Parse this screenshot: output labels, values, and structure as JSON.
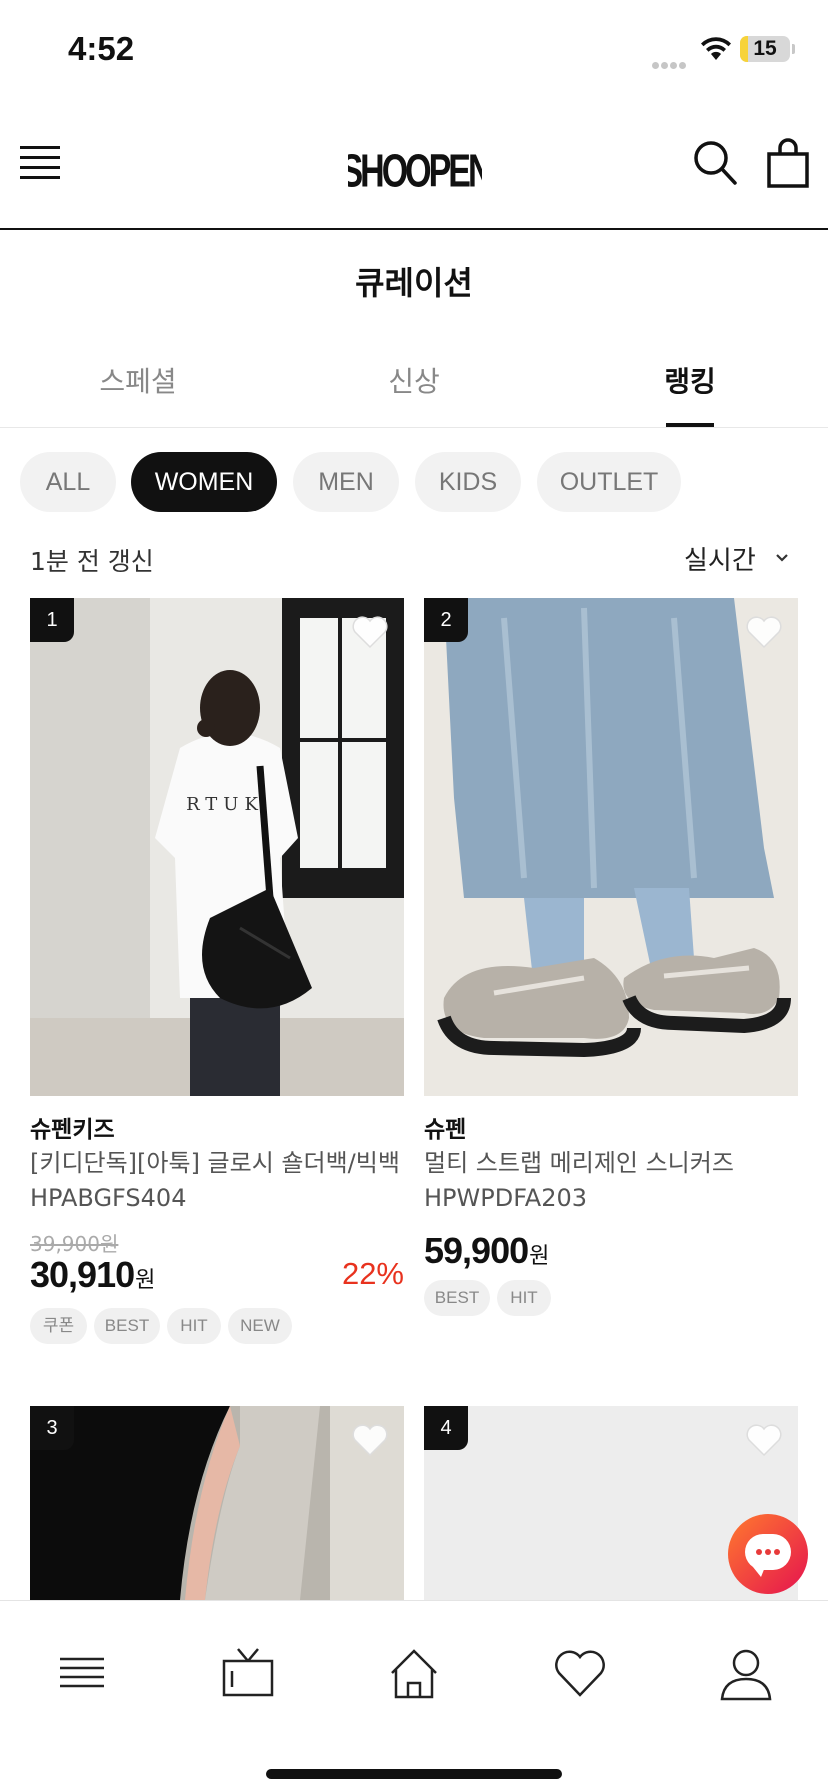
{
  "status_bar": {
    "time": "4:52",
    "battery": "15",
    "battery_level": 0.15
  },
  "header": {
    "logo_text": "SHOOPEN"
  },
  "page": {
    "title": "큐레이션"
  },
  "tabs": [
    {
      "label": "스페셜",
      "active": false
    },
    {
      "label": "신상",
      "active": false
    },
    {
      "label": "랭킹",
      "active": true
    }
  ],
  "filters": [
    {
      "label": "ALL",
      "active": false
    },
    {
      "label": "WOMEN",
      "active": true
    },
    {
      "label": "MEN",
      "active": false
    },
    {
      "label": "KIDS",
      "active": false
    },
    {
      "label": "OUTLET",
      "active": false
    }
  ],
  "update_text": "1분 전 갱신",
  "sort": {
    "selected": "실시간"
  },
  "products": [
    {
      "rank": "1",
      "brand": "슈펜키즈",
      "name_line1": "[키디단독][아툭] 글로시 숄더백/빅백",
      "name_line2": "HPABGFS404",
      "original_price": "39,900원",
      "price": "30,910",
      "currency": "원",
      "discount": "22%",
      "badges": [
        "쿠폰",
        "BEST",
        "HIT",
        "NEW"
      ],
      "shirt_print": "RTUK"
    },
    {
      "rank": "2",
      "brand": "슈펜",
      "name_line1": "멀티 스트랩 메리제인 스니커즈",
      "name_line2": "HPWPDFA203",
      "price": "59,900",
      "currency": "원",
      "badges": [
        "BEST",
        "HIT"
      ]
    },
    {
      "rank": "3"
    },
    {
      "rank": "4"
    }
  ],
  "colors": {
    "accent_discount": "#e8321e",
    "active_chip": "#111111",
    "chat_gradient_start": "#ff7a2e",
    "chat_gradient_end": "#e5134f"
  },
  "icons": {
    "header": [
      "menu-icon",
      "search-icon",
      "shopping-bag-icon"
    ],
    "bottom_nav": [
      "menu-icon",
      "tv-icon",
      "home-icon",
      "heart-icon",
      "user-icon"
    ]
  }
}
